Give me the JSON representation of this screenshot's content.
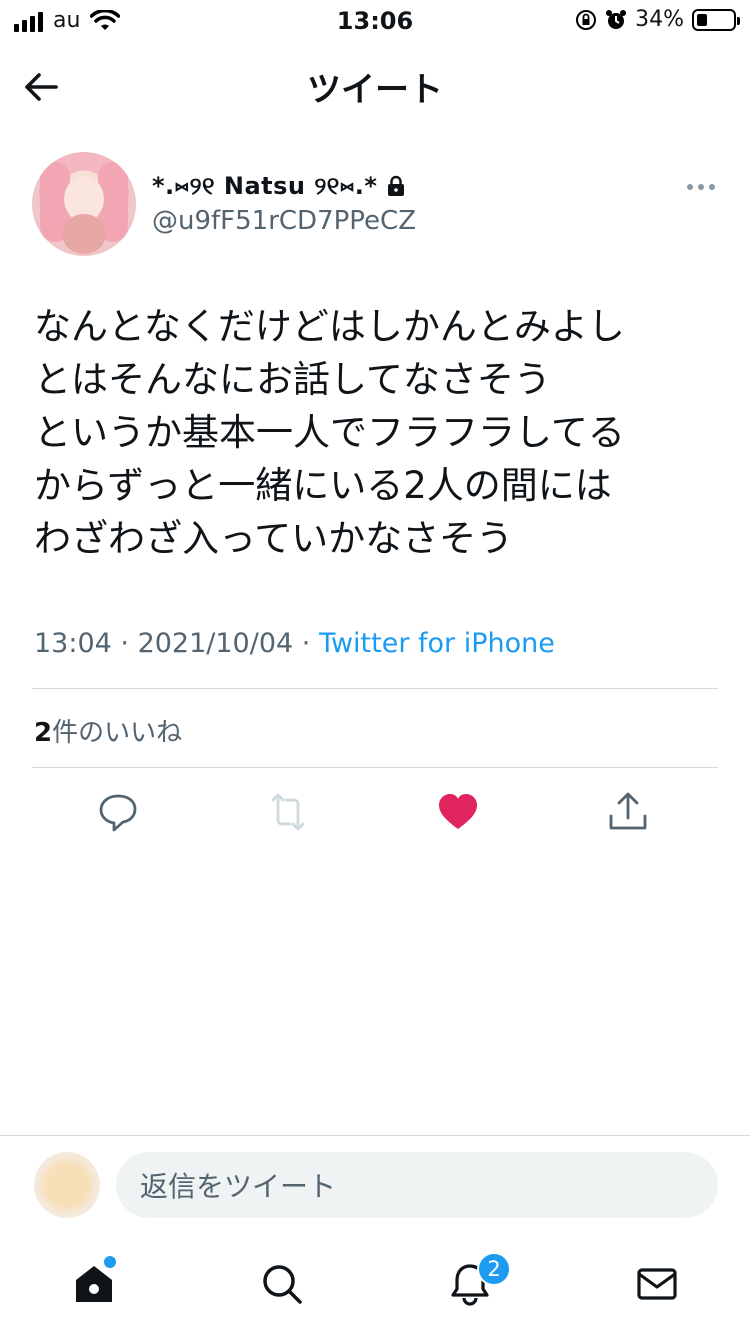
{
  "status_bar": {
    "carrier": "au",
    "time": "13:06",
    "battery": "34%"
  },
  "header": {
    "title": "ツイート"
  },
  "tweet": {
    "display_name": "*.⑅୨୧ Natsu ୨୧⑅.*",
    "handle": "@u9fF51rCD7PPeCZ",
    "text": "なんとなくだけどはしかんとみよし\nとはそんなにお話してなさそう\nというか基本一人でフラフラしてる\nからずっと一緒にいる2人の間には\nわざわざ入っていかなさそう",
    "time": "13:04",
    "date": "2021/10/04",
    "source": "Twitter for iPhone",
    "likes_count": "2",
    "likes_label": "件のいいね"
  },
  "reply": {
    "placeholder": "返信をツイート"
  },
  "tabbar": {
    "notification_count": "2"
  },
  "colors": {
    "accent": "#1d9bf0",
    "like": "#f91880",
    "muted": "#536471"
  }
}
